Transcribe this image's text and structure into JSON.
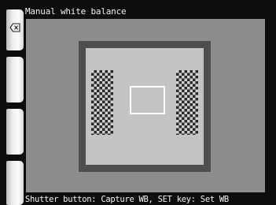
{
  "header": {
    "title": "Manual white balance"
  },
  "side_buttons": {
    "back_icon": "backspace-x-icon"
  },
  "footer": {
    "hint": "Shutter button: Capture WB, SET key: Set WB"
  },
  "colors": {
    "background": "#0d0d0d",
    "text": "#f2f2f2",
    "viewfinder": "#8d8d8d",
    "frame": "#ffffff"
  }
}
